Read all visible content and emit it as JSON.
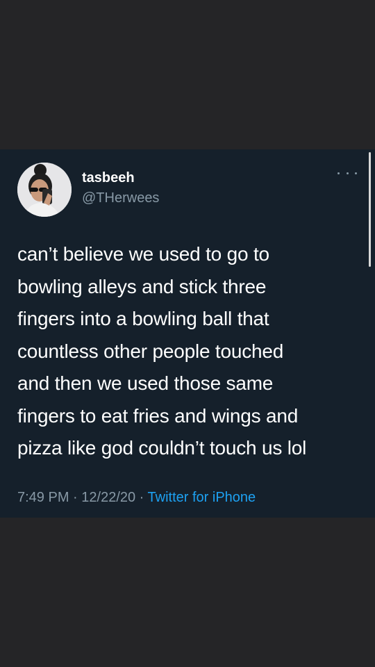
{
  "tweet": {
    "display_name": "tasbeeh",
    "handle": "@THerwees",
    "text": "can’t believe we used to go to\nbowling alleys and stick three\nfingers into a bowling ball that\ncountless other people touched\nand then we used those same\nfingers to eat fries and wings and\npizza like god couldn’t touch us lol",
    "time": "7:49 PM",
    "separator": " · ",
    "date": "12/22/20",
    "source": "Twitter for iPhone"
  },
  "icons": {
    "more": "more-horizontal-icon",
    "avatar": "profile-photo"
  },
  "colors": {
    "outer_background": "#252527",
    "card_background": "#15202b",
    "primary_text": "#ffffff",
    "secondary_text": "#8899a6",
    "link": "#1da1f2"
  }
}
